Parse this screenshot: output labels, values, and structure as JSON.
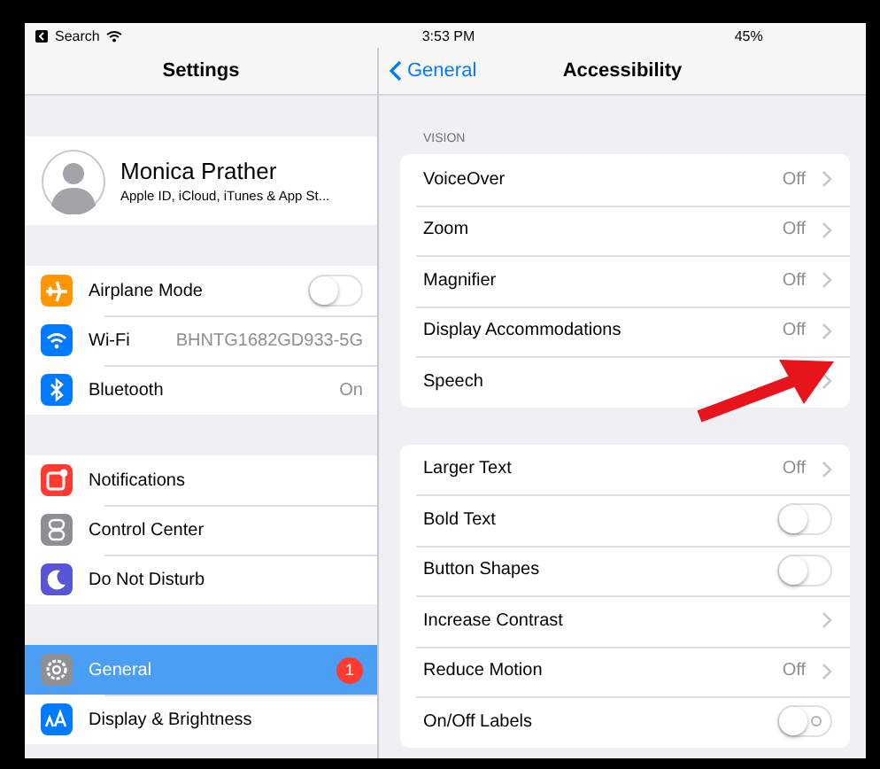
{
  "status_bar": {
    "back_app": "Search",
    "time": "3:53 PM",
    "battery": "45%"
  },
  "sidebar": {
    "title": "Settings",
    "profile": {
      "name": "Monica Prather",
      "subtitle": "Apple ID, iCloud, iTunes & App St..."
    },
    "groups": [
      {
        "items": [
          {
            "label": "Airplane Mode",
            "kind": "toggle",
            "on": false,
            "color": "#ff9500",
            "selected": false
          },
          {
            "label": "Wi-Fi",
            "kind": "value",
            "value": "BHNTG1682GD933-5G",
            "color": "#007aff",
            "selected": false
          },
          {
            "label": "Bluetooth",
            "kind": "value",
            "value": "On",
            "color": "#007aff",
            "selected": false
          }
        ]
      },
      {
        "items": [
          {
            "label": "Notifications",
            "kind": "plain",
            "color": "#ff3b30",
            "selected": false
          },
          {
            "label": "Control Center",
            "kind": "plain",
            "color": "#8e8e93",
            "selected": false
          },
          {
            "label": "Do Not Disturb",
            "kind": "plain",
            "color": "#5856d6",
            "selected": false
          }
        ]
      },
      {
        "items": [
          {
            "label": "General",
            "kind": "badge",
            "badge": "1",
            "color": "#8e8e93",
            "selected": true
          },
          {
            "label": "Display & Brightness",
            "kind": "plain",
            "color": "#007aff",
            "selected": false
          }
        ]
      }
    ]
  },
  "detail": {
    "back": "General",
    "title": "Accessibility",
    "sections": [
      {
        "header": "VISION",
        "rows": [
          {
            "label": "VoiceOver",
            "kind": "value",
            "value": "Off"
          },
          {
            "label": "Zoom",
            "kind": "value",
            "value": "Off"
          },
          {
            "label": "Magnifier",
            "kind": "value",
            "value": "Off"
          },
          {
            "label": "Display Accommodations",
            "kind": "value",
            "value": "Off"
          },
          {
            "label": "Speech",
            "kind": "chevron"
          }
        ]
      },
      {
        "rows": [
          {
            "label": "Larger Text",
            "kind": "value",
            "value": "Off"
          },
          {
            "label": "Bold Text",
            "kind": "toggle",
            "on": false
          },
          {
            "label": "Button Shapes",
            "kind": "toggle",
            "on": false
          },
          {
            "label": "Increase Contrast",
            "kind": "chevron"
          },
          {
            "label": "Reduce Motion",
            "kind": "value",
            "value": "Off"
          },
          {
            "label": "On/Off Labels",
            "kind": "toggle",
            "on": false,
            "labels": true
          }
        ]
      }
    ]
  }
}
